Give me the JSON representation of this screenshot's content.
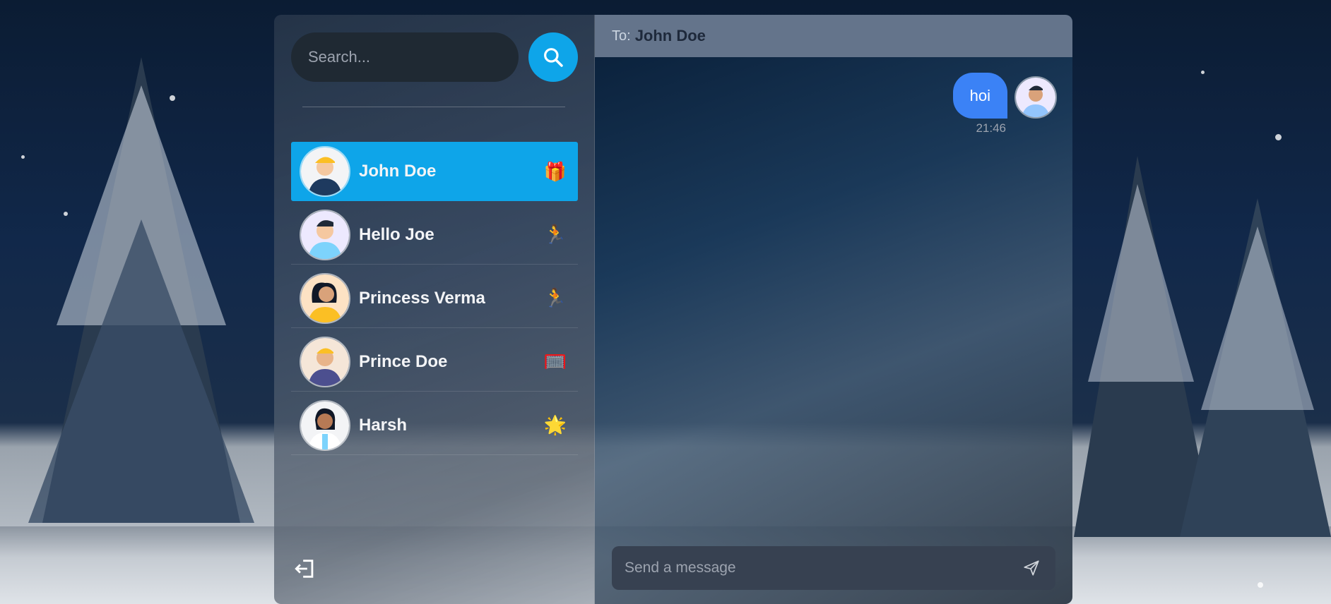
{
  "search": {
    "placeholder": "Search..."
  },
  "contacts": [
    {
      "name": "John Doe",
      "emoji": "🎁",
      "active": true,
      "avatar_color": "#fde68a",
      "shirt_color": "#1e3a5f"
    },
    {
      "name": "Hello Joe",
      "emoji": "🏃",
      "active": false,
      "avatar_color": "#e5e7eb",
      "shirt_color": "#7dd3fc"
    },
    {
      "name": "Princess Verma",
      "emoji": "🏃",
      "active": false,
      "avatar_color": "#fde2c4",
      "shirt_color": "#fbbf24"
    },
    {
      "name": "Prince Doe",
      "emoji": "🥅",
      "active": false,
      "avatar_color": "#fde2c4",
      "shirt_color": "#4f46e5"
    },
    {
      "name": "Harsh",
      "emoji": "🌟",
      "active": false,
      "avatar_color": "#f3f4f6",
      "shirt_color": "#7dd3fc"
    }
  ],
  "chat": {
    "to_label": "To:",
    "to_name": "John Doe",
    "messages": [
      {
        "text": "hoi",
        "time": "21:46",
        "outgoing": true
      }
    ],
    "composer_placeholder": "Send a message"
  },
  "colors": {
    "accent": "#0ea5e9",
    "bubble": "#3b82f6",
    "header": "#64748b"
  },
  "icons": {
    "search": "search-icon",
    "logout": "logout-icon",
    "send": "send-icon"
  }
}
